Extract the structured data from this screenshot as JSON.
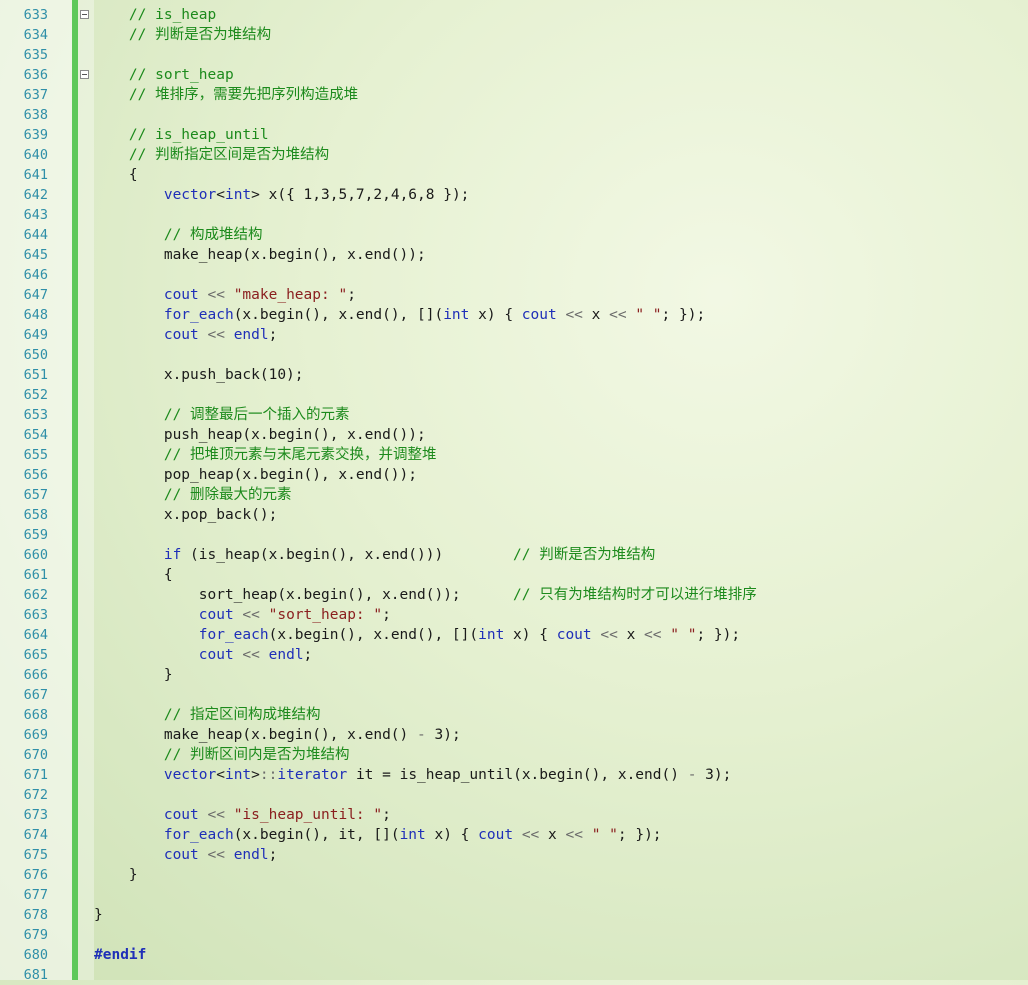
{
  "editor": {
    "lines": [
      {
        "num": "633",
        "code": "    // is_heap",
        "type": "comment",
        "fold": true
      },
      {
        "num": "634",
        "code": "    // 判断是否为堆结构",
        "type": "comment",
        "fold": false
      },
      {
        "num": "635",
        "code": "",
        "type": "plain",
        "fold": false
      },
      {
        "num": "636",
        "code": "    // sort_heap",
        "type": "comment",
        "fold": true
      },
      {
        "num": "637",
        "code": "    // 堆排序，需要先把序列构造成堆",
        "type": "comment",
        "fold": false
      },
      {
        "num": "638",
        "code": "",
        "type": "plain",
        "fold": false
      },
      {
        "num": "639",
        "code": "    // is_heap_until",
        "type": "comment",
        "fold": false
      },
      {
        "num": "640",
        "code": "    // 判断指定区间是否为堆结构",
        "type": "comment",
        "fold": false
      },
      {
        "num": "641",
        "code": "    {",
        "type": "plain",
        "fold": false
      },
      {
        "num": "642",
        "code": "        vector<int> x({ 1,3,5,7,2,4,6,8 });",
        "type": "plain",
        "fold": false
      },
      {
        "num": "643",
        "code": "",
        "type": "plain",
        "fold": false
      },
      {
        "num": "644",
        "code": "        // 构成堆结构",
        "type": "comment",
        "fold": false
      },
      {
        "num": "645",
        "code": "        make_heap(x.begin(), x.end());",
        "type": "plain",
        "fold": false
      },
      {
        "num": "646",
        "code": "",
        "type": "plain",
        "fold": false
      },
      {
        "num": "647",
        "code": "        cout << \"make_heap: \";",
        "type": "plain",
        "fold": false
      },
      {
        "num": "648",
        "code": "        for_each(x.begin(), x.end(), [](int x) { cout << x << \" \"; });",
        "type": "plain",
        "fold": false
      },
      {
        "num": "649",
        "code": "        cout << endl;",
        "type": "plain",
        "fold": false
      },
      {
        "num": "650",
        "code": "",
        "type": "plain",
        "fold": false
      },
      {
        "num": "651",
        "code": "        x.push_back(10);",
        "type": "plain",
        "fold": false
      },
      {
        "num": "652",
        "code": "",
        "type": "plain",
        "fold": false
      },
      {
        "num": "653",
        "code": "        // 调整最后一个插入的元素",
        "type": "comment",
        "fold": false
      },
      {
        "num": "654",
        "code": "        push_heap(x.begin(), x.end());",
        "type": "plain",
        "fold": false
      },
      {
        "num": "655",
        "code": "        // 把堆顶元素与末尾元素交换，并调整堆",
        "type": "comment",
        "fold": false
      },
      {
        "num": "656",
        "code": "        pop_heap(x.begin(), x.end());",
        "type": "plain",
        "fold": false
      },
      {
        "num": "657",
        "code": "        // 删除最大的元素",
        "type": "comment",
        "fold": false
      },
      {
        "num": "658",
        "code": "        x.pop_back();",
        "type": "plain",
        "fold": false
      },
      {
        "num": "659",
        "code": "",
        "type": "plain",
        "fold": false
      },
      {
        "num": "660",
        "code": "        if (is_heap(x.begin(), x.end()))        // 判断是否为堆结构",
        "type": "plain",
        "fold": false
      },
      {
        "num": "661",
        "code": "        {",
        "type": "plain",
        "fold": false
      },
      {
        "num": "662",
        "code": "            sort_heap(x.begin(), x.end());      // 只有为堆结构时才可以进行堆排序",
        "type": "plain",
        "fold": false
      },
      {
        "num": "663",
        "code": "            cout << \"sort_heap: \";",
        "type": "plain",
        "fold": false
      },
      {
        "num": "664",
        "code": "            for_each(x.begin(), x.end(), [](int x) { cout << x << \" \"; });",
        "type": "plain",
        "fold": false
      },
      {
        "num": "665",
        "code": "            cout << endl;",
        "type": "plain",
        "fold": false
      },
      {
        "num": "666",
        "code": "        }",
        "type": "plain",
        "fold": false
      },
      {
        "num": "667",
        "code": "",
        "type": "plain",
        "fold": false
      },
      {
        "num": "668",
        "code": "        // 指定区间构成堆结构",
        "type": "comment",
        "fold": false
      },
      {
        "num": "669",
        "code": "        make_heap(x.begin(), x.end() - 3);",
        "type": "plain",
        "fold": false
      },
      {
        "num": "670",
        "code": "        // 判断区间内是否为堆结构",
        "type": "comment",
        "fold": false
      },
      {
        "num": "671",
        "code": "        vector<int>::iterator it = is_heap_until(x.begin(), x.end() - 3);",
        "type": "plain",
        "fold": false
      },
      {
        "num": "672",
        "code": "",
        "type": "plain",
        "fold": false
      },
      {
        "num": "673",
        "code": "        cout << \"is_heap_until: \";",
        "type": "plain",
        "fold": false
      },
      {
        "num": "674",
        "code": "        for_each(x.begin(), it, [](int x) { cout << x << \" \"; });",
        "type": "plain",
        "fold": false
      },
      {
        "num": "675",
        "code": "        cout << endl;",
        "type": "plain",
        "fold": false
      },
      {
        "num": "676",
        "code": "    }",
        "type": "plain",
        "fold": false
      },
      {
        "num": "677",
        "code": "",
        "type": "plain",
        "fold": false
      },
      {
        "num": "678",
        "code": "}",
        "type": "plain",
        "fold": false
      },
      {
        "num": "679",
        "code": "",
        "type": "plain",
        "fold": false
      },
      {
        "num": "680",
        "code": "#endif",
        "type": "directive",
        "fold": false
      },
      {
        "num": "681",
        "code": "",
        "type": "plain",
        "fold": false
      }
    ],
    "colors": {
      "line_number": "#2f8fa8",
      "change_bar": "#5ec85a",
      "comment": "#1c8a1c",
      "keyword": "#1f2fb8",
      "string": "#8a1e1e"
    }
  }
}
